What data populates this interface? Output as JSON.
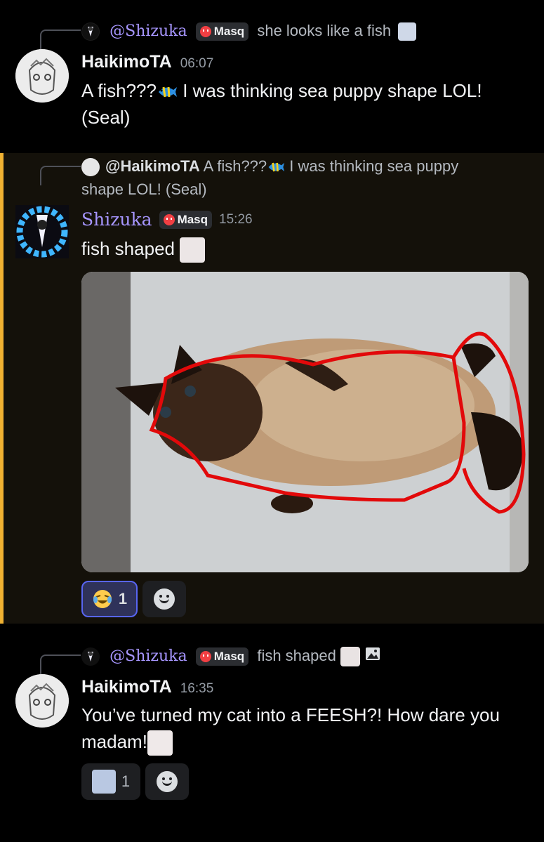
{
  "messages": [
    {
      "reply": {
        "author": "@Shizuka",
        "tag": "Masq",
        "text": "she looks like a fish"
      },
      "author": "HaikimoTA",
      "time": "06:07",
      "text_a": "A fish???",
      "text_b": " I was thinking sea puppy shape LOL! (Seal)"
    },
    {
      "reply": {
        "author": "@HaikimoTA",
        "text_a": "A fish???",
        "text_b": " I was thinking sea puppy shape LOL! (Seal)"
      },
      "author": "Shizuka",
      "tag": "Masq",
      "time": "15:26",
      "text": "fish shaped",
      "reactions": [
        {
          "emoji": "joy",
          "count": "1"
        }
      ]
    },
    {
      "reply": {
        "author": "@Shizuka",
        "tag": "Masq",
        "text": "fish shaped"
      },
      "author": "HaikimoTA",
      "time": "16:35",
      "text": "You’ve turned my cat into a FEESH?! How dare you madam!",
      "reactions": [
        {
          "emoji": "custom",
          "count": "1"
        }
      ]
    }
  ],
  "colors": {
    "highlight_bar": "#f0b232",
    "shizuka_name": "#a796ff",
    "tag_icon": "#f23f43"
  },
  "icons": [
    "image-icon",
    "add-reaction-icon",
    "tropical-fish-emoji",
    "joy-emoji"
  ]
}
